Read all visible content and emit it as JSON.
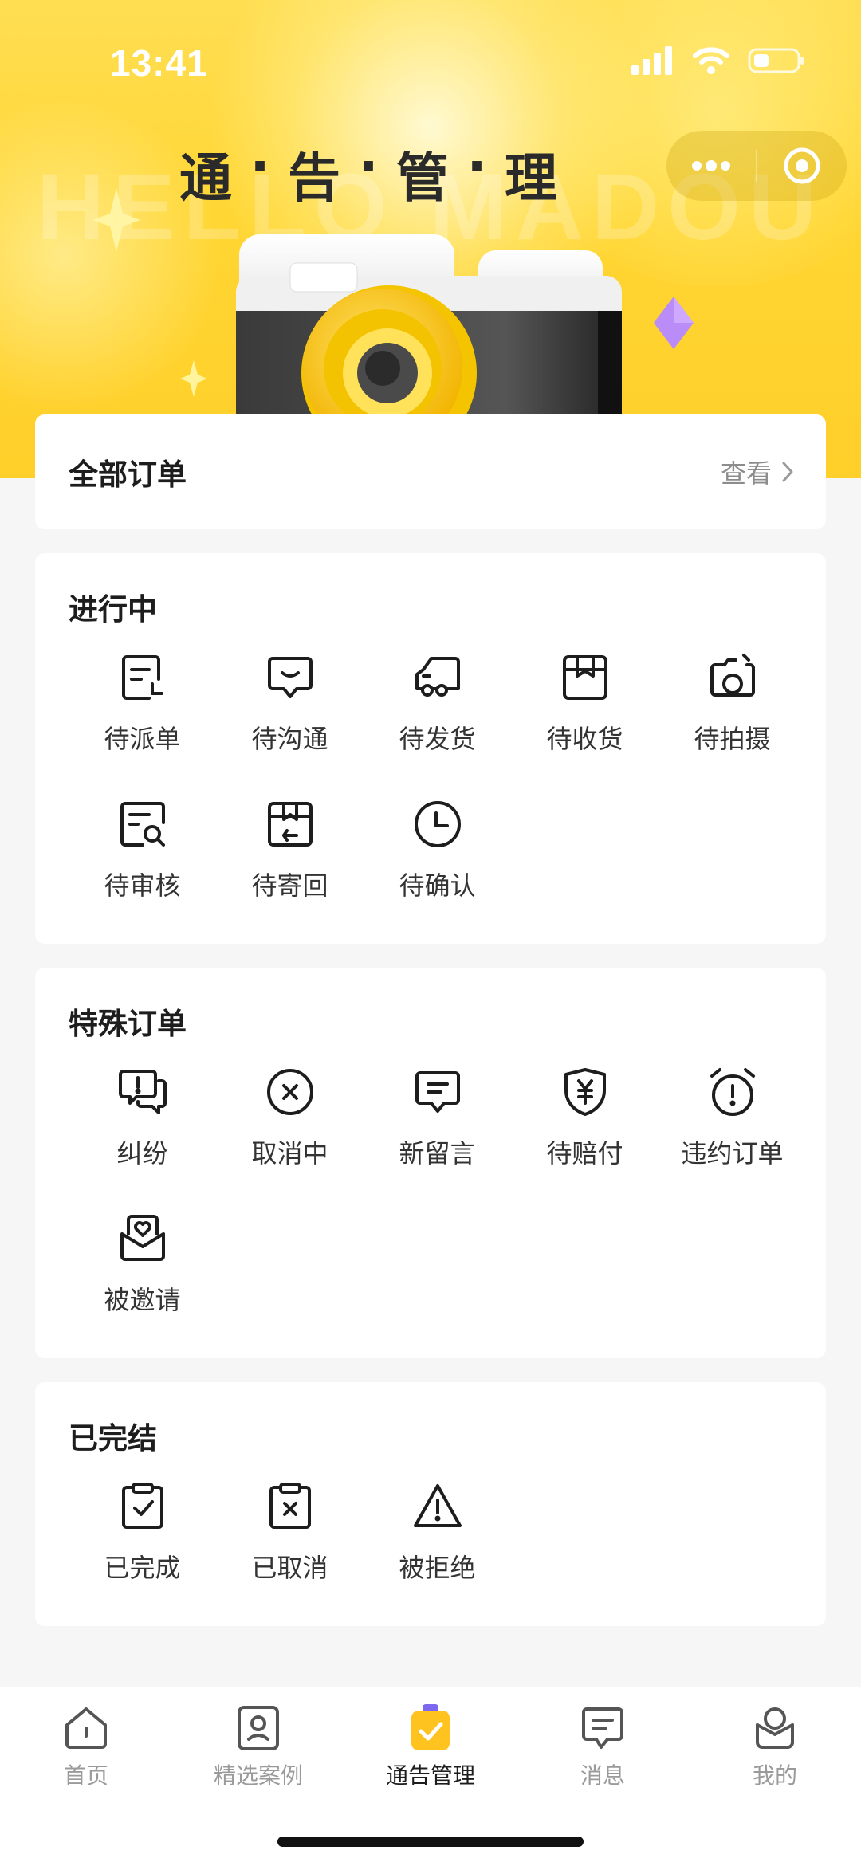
{
  "status_bar": {
    "time": "13:41"
  },
  "header": {
    "watermark": "HELLO MADOU",
    "title_chars": [
      "通",
      "告",
      "管",
      "理"
    ],
    "title_separator": "·"
  },
  "all_orders": {
    "title": "全部订单",
    "link_label": "查看"
  },
  "sections": {
    "in_progress": {
      "title": "进行中",
      "items": [
        {
          "label": "待派单",
          "icon": "dispatch-doc-icon"
        },
        {
          "label": "待沟通",
          "icon": "chat-bubble-icon"
        },
        {
          "label": "待发货",
          "icon": "truck-icon"
        },
        {
          "label": "待收货",
          "icon": "package-box-icon"
        },
        {
          "label": "待拍摄",
          "icon": "camera-icon"
        },
        {
          "label": "待审核",
          "icon": "doc-search-icon"
        },
        {
          "label": "待寄回",
          "icon": "return-box-icon"
        },
        {
          "label": "待确认",
          "icon": "clock-icon"
        }
      ]
    },
    "special": {
      "title": "特殊订单",
      "items": [
        {
          "label": "纠纷",
          "icon": "dispute-chat-icon"
        },
        {
          "label": "取消中",
          "icon": "cancel-circle-icon"
        },
        {
          "label": "新留言",
          "icon": "message-icon"
        },
        {
          "label": "待赔付",
          "icon": "yuan-shield-icon"
        },
        {
          "label": "违约订单",
          "icon": "alarm-clock-icon"
        },
        {
          "label": "被邀请",
          "icon": "invite-envelope-icon"
        }
      ]
    },
    "completed": {
      "title": "已完结",
      "items": [
        {
          "label": "已完成",
          "icon": "clipboard-check-icon"
        },
        {
          "label": "已取消",
          "icon": "clipboard-x-icon"
        },
        {
          "label": "被拒绝",
          "icon": "warning-triangle-icon"
        }
      ]
    }
  },
  "tabbar": {
    "active": "通告管理",
    "items": [
      {
        "label": "首页",
        "icon": "home-icon"
      },
      {
        "label": "精选案例",
        "icon": "portfolio-icon"
      },
      {
        "label": "通告管理",
        "icon": "announcement-icon"
      },
      {
        "label": "消息",
        "icon": "message-tab-icon"
      },
      {
        "label": "我的",
        "icon": "profile-bag-icon"
      }
    ]
  },
  "colors": {
    "brand_yellow": "#ffd633",
    "background": "#f6f6f6",
    "card": "#ffffff",
    "text_primary": "#1d1d1d",
    "text_secondary": "#8c8c8c",
    "tab_inactive": "#9a9a9a"
  }
}
